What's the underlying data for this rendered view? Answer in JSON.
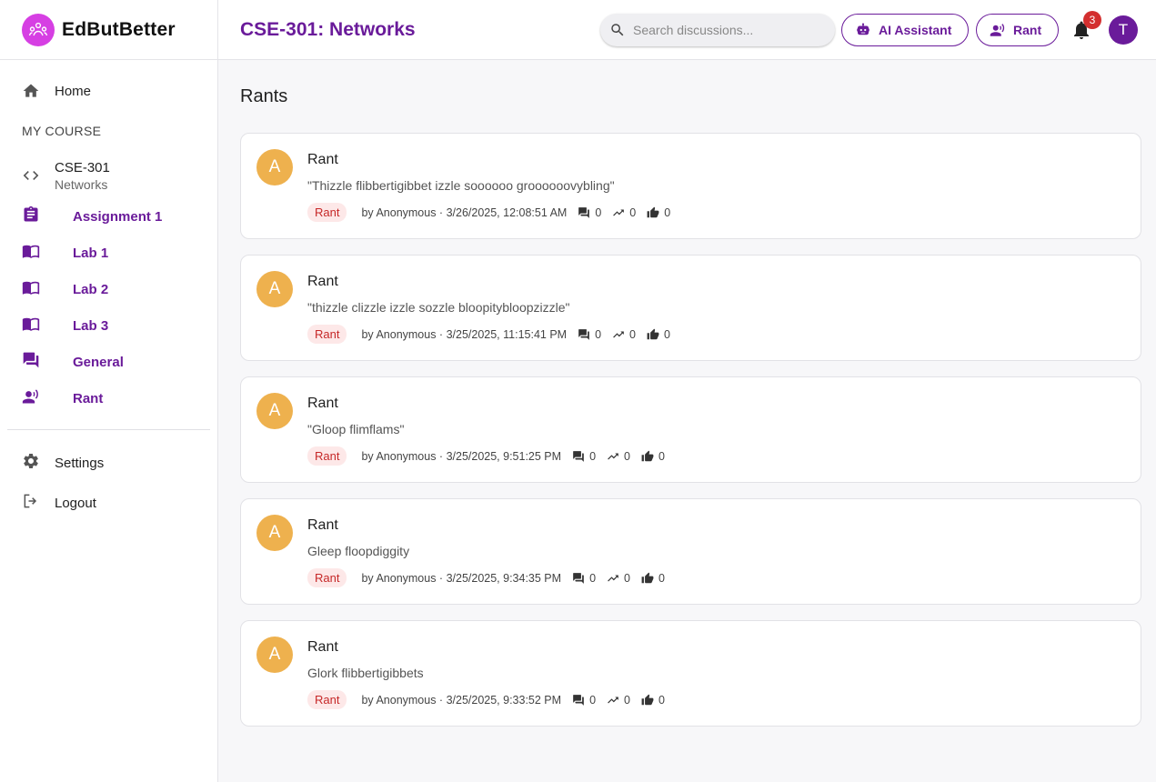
{
  "brand": {
    "name": "EdButBetter",
    "accent": "#d63fe3"
  },
  "sidebar": {
    "home": "Home",
    "section_label": "MY COURSE",
    "course": {
      "code": "CSE-301",
      "name": "Networks"
    },
    "sub_items": [
      {
        "label": "Assignment 1",
        "icon": "assignment-icon"
      },
      {
        "label": "Lab 1",
        "icon": "book-icon"
      },
      {
        "label": "Lab 2",
        "icon": "book-icon"
      },
      {
        "label": "Lab 3",
        "icon": "book-icon"
      },
      {
        "label": "General",
        "icon": "forum-icon"
      },
      {
        "label": "Rant",
        "icon": "speaker-person-icon"
      }
    ],
    "settings": "Settings",
    "logout": "Logout"
  },
  "topbar": {
    "course_title": "CSE-301: Networks",
    "search_placeholder": "Search discussions...",
    "ai_button": "AI Assistant",
    "rant_button": "Rant",
    "notification_count": "3",
    "user_initial": "T",
    "primary_color": "#6a1b9a"
  },
  "main": {
    "title": "Rants",
    "posts": [
      {
        "avatar": "A",
        "title": "Rant",
        "body": "\"Thizzle flibbertigibbet izzle soooooo groooooovybling\"",
        "tag": "Rant",
        "meta": "by Anonymous · 3/26/2025, 12:08:51 AM",
        "comments": "0",
        "views": "0",
        "likes": "0"
      },
      {
        "avatar": "A",
        "title": "Rant",
        "body": "\"thizzle clizzle izzle sozzle bloopitybloopzizzle\"",
        "tag": "Rant",
        "meta": "by Anonymous · 3/25/2025, 11:15:41 PM",
        "comments": "0",
        "views": "0",
        "likes": "0"
      },
      {
        "avatar": "A",
        "title": "Rant",
        "body": "\"Gloop flimflams\"",
        "tag": "Rant",
        "meta": "by Anonymous · 3/25/2025, 9:51:25 PM",
        "comments": "0",
        "views": "0",
        "likes": "0"
      },
      {
        "avatar": "A",
        "title": "Rant",
        "body": "Gleep floopdiggity",
        "tag": "Rant",
        "meta": "by Anonymous · 3/25/2025, 9:34:35 PM",
        "comments": "0",
        "views": "0",
        "likes": "0"
      },
      {
        "avatar": "A",
        "title": "Rant",
        "body": "Glork flibbertigibbets",
        "tag": "Rant",
        "meta": "by Anonymous · 3/25/2025, 9:33:52 PM",
        "comments": "0",
        "views": "0",
        "likes": "0"
      }
    ]
  }
}
